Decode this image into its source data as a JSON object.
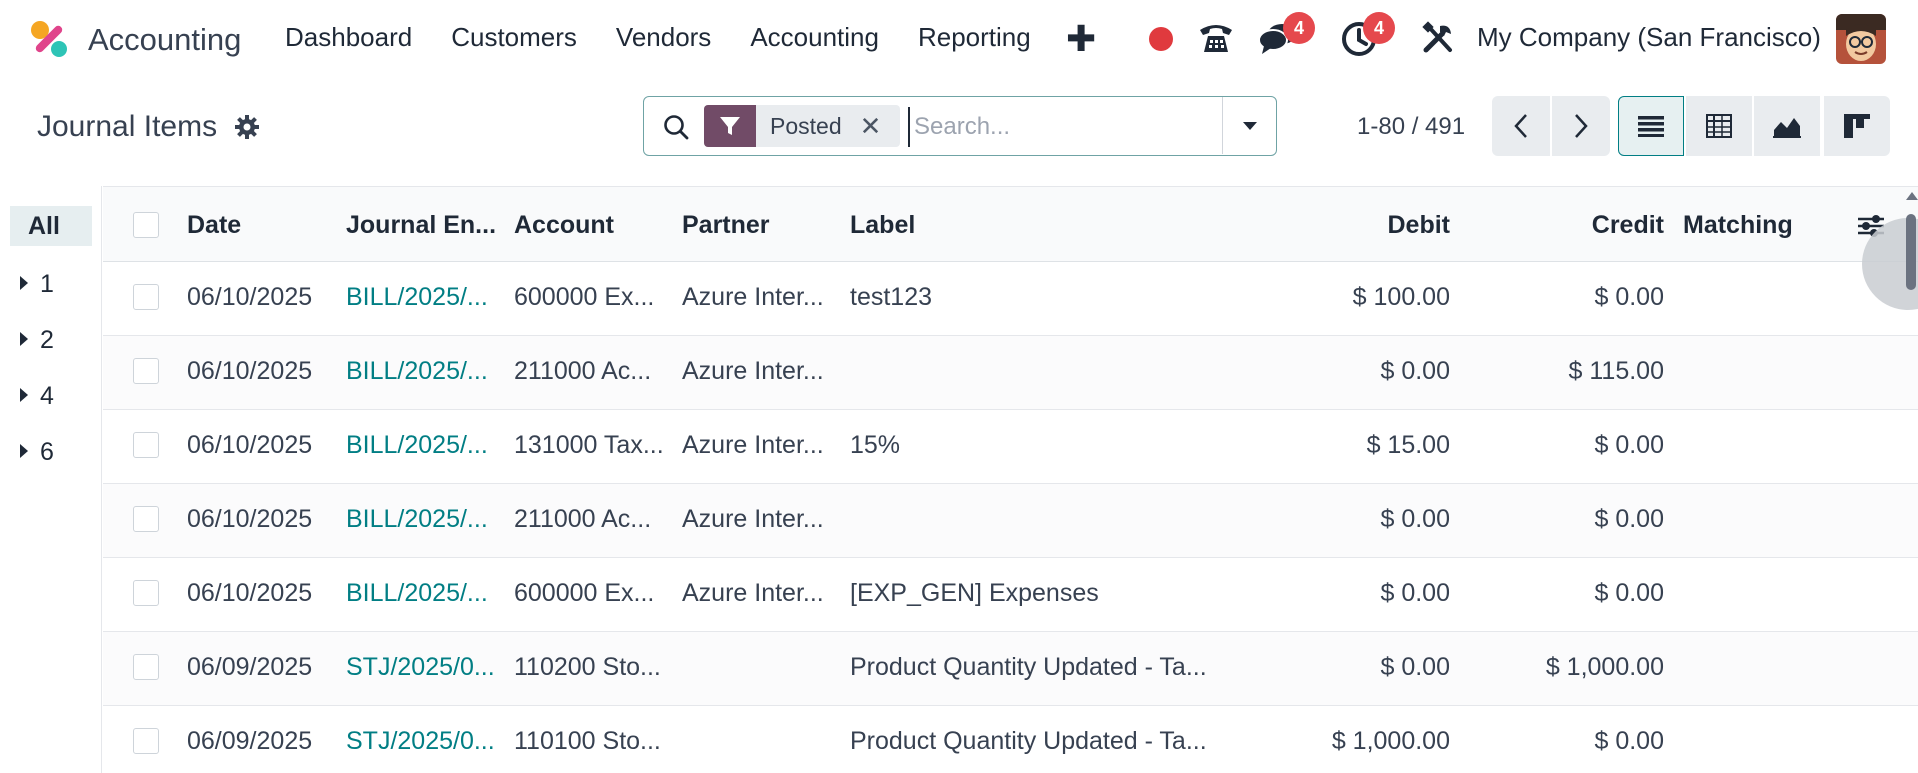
{
  "app": {
    "name": "Accounting"
  },
  "menu": [
    "Dashboard",
    "Customers",
    "Vendors",
    "Accounting",
    "Reporting"
  ],
  "systray": {
    "chat_count": "4",
    "activity_count": "4",
    "company": "My Company (San Francisco)"
  },
  "control": {
    "title": "Journal Items",
    "facet": "Posted",
    "search_placeholder": "Search...",
    "pager": "1-80 / 491"
  },
  "side_panel": {
    "all": "All",
    "items": [
      "1",
      "2",
      "4",
      "6"
    ]
  },
  "table": {
    "headers": [
      "Date",
      "Journal En...",
      "Account",
      "Partner",
      "Label",
      "Debit",
      "Credit",
      "Matching"
    ],
    "rows": [
      {
        "date": "06/10/2025",
        "entry": "BILL/2025/...",
        "account": "600000 Ex...",
        "partner": "Azure Inter...",
        "label": "test123",
        "debit": "$ 100.00",
        "credit": "$ 0.00",
        "matching": ""
      },
      {
        "date": "06/10/2025",
        "entry": "BILL/2025/...",
        "account": "211000 Ac...",
        "partner": "Azure Inter...",
        "label": "",
        "debit": "$ 0.00",
        "credit": "$ 115.00",
        "matching": ""
      },
      {
        "date": "06/10/2025",
        "entry": "BILL/2025/...",
        "account": "131000 Tax...",
        "partner": "Azure Inter...",
        "label": "15%",
        "debit": "$ 15.00",
        "credit": "$ 0.00",
        "matching": ""
      },
      {
        "date": "06/10/2025",
        "entry": "BILL/2025/...",
        "account": "211000 Ac...",
        "partner": "Azure Inter...",
        "label": "",
        "debit": "$ 0.00",
        "credit": "$ 0.00",
        "matching": ""
      },
      {
        "date": "06/10/2025",
        "entry": "BILL/2025/...",
        "account": "600000 Ex...",
        "partner": "Azure Inter...",
        "label": "[EXP_GEN] Expenses",
        "debit": "$ 0.00",
        "credit": "$ 0.00",
        "matching": ""
      },
      {
        "date": "06/09/2025",
        "entry": "STJ/2025/0...",
        "account": "110200 Sto...",
        "partner": "",
        "label": "Product Quantity Updated - Ta...",
        "debit": "$ 0.00",
        "credit": "$ 1,000.00",
        "matching": ""
      },
      {
        "date": "06/09/2025",
        "entry": "STJ/2025/0...",
        "account": "110100 Sto...",
        "partner": "",
        "label": "Product Quantity Updated - Ta...",
        "debit": "$ 1,000.00",
        "credit": "$ 0.00",
        "matching": ""
      }
    ]
  },
  "colors": {
    "brand": "#714b67",
    "accent": "#017e84",
    "badge": "#e5484d"
  }
}
